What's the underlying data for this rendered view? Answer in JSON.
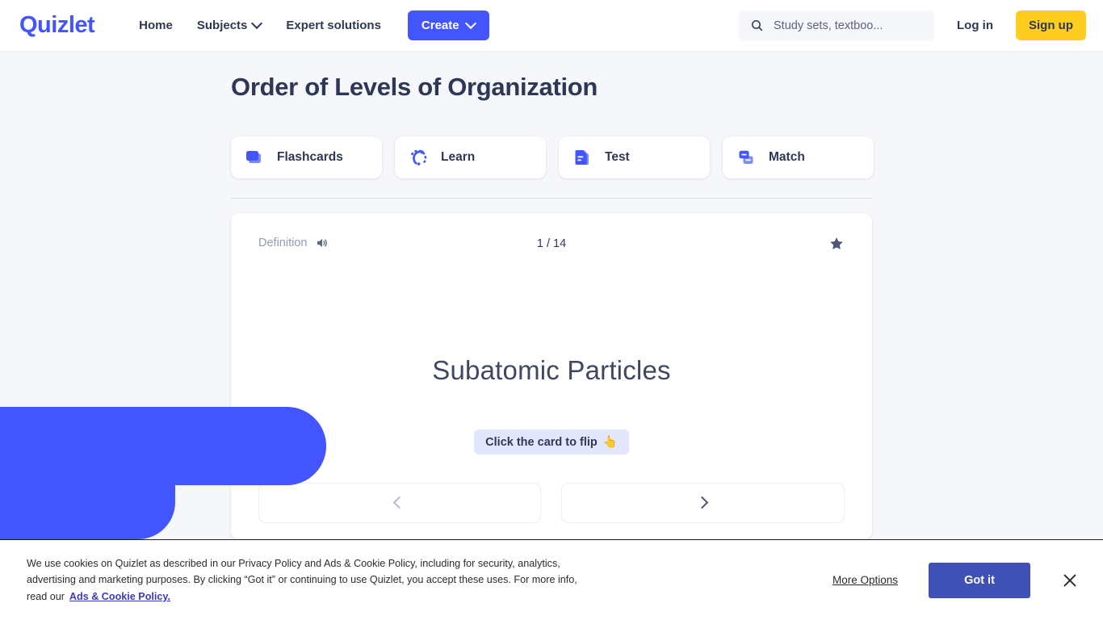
{
  "header": {
    "logo": "Quizlet",
    "nav": [
      {
        "label": "Home",
        "has_chevron": false,
        "icon": ""
      },
      {
        "label": "Subjects",
        "has_chevron": true,
        "icon": "chevron-down-icon"
      },
      {
        "label": "Expert solutions",
        "has_chevron": false,
        "icon": ""
      }
    ],
    "create_label": "Create",
    "search": {
      "placeholder": "Study sets, textboo...",
      "value": "",
      "icon": "search-icon"
    },
    "login_label": "Log in",
    "signup_label": "Sign up"
  },
  "main": {
    "title": "Order of Levels of Organization",
    "modes": [
      {
        "label": "Flashcards",
        "icon": "flashcards-icon"
      },
      {
        "label": "Learn",
        "icon": "learn-icon"
      },
      {
        "label": "Test",
        "icon": "test-icon"
      },
      {
        "label": "Match",
        "icon": "match-icon"
      }
    ]
  },
  "flashcard": {
    "side_label": "Definition",
    "audio_icon": "speaker-icon",
    "counter": "1 / 14",
    "star_icon": "star-filled-icon",
    "term": "Subatomic Particles",
    "flip_hint": "Click the card to flip",
    "flip_hint_emoji": "👆",
    "prev_icon": "chevron-left-icon",
    "next_icon": "chevron-right-icon"
  },
  "cookie_banner": {
    "body": "We use cookies on Quizlet as described in our Privacy Policy and Ads & Cookie Policy, including for security, analytics, advertising and marketing purposes. By clicking “Got it” or continuing to use Quizlet, you accept these uses. For more info, read our",
    "policy_link": "Ads & Cookie Policy.",
    "more_options": "More Options",
    "got_it": "Got it",
    "close_icon": "close-icon"
  },
  "colors": {
    "brand_indigo": "#4255ff",
    "brand_yellow": "#ffcd1f",
    "page_bg": "#f6f7fb",
    "text_dark": "#2e3856",
    "muted": "#939bb4",
    "banner_button": "#3f51b5",
    "hint_bg": "#e3e7fc"
  }
}
